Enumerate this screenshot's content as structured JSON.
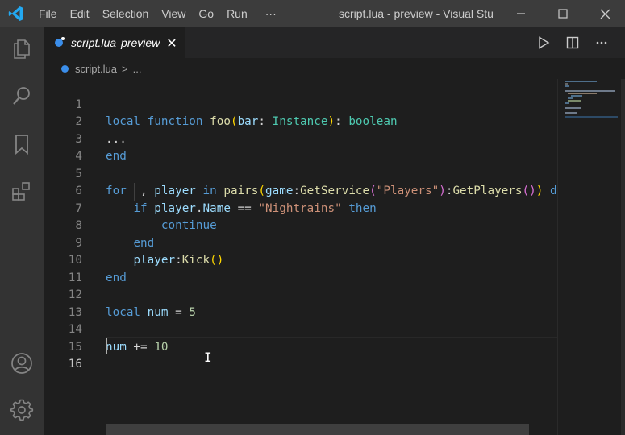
{
  "titlebar": {
    "menus": [
      "File",
      "Edit",
      "Selection",
      "View",
      "Go",
      "Run",
      "···"
    ],
    "title": "script.lua - preview - Visual Stu"
  },
  "tab": {
    "name": "script.lua",
    "suffix": "preview",
    "close": "✕"
  },
  "breadcrumb": {
    "file": "script.lua",
    "separator": ">",
    "more": "..."
  },
  "editor": {
    "line_numbers": [
      "1",
      "2",
      "3",
      "4",
      "5",
      "6",
      "7",
      "8",
      "9",
      "10",
      "11",
      "12",
      "13",
      "14",
      "15",
      "16"
    ]
  },
  "colors": {
    "accent": "#007acc",
    "keyword": "#569cd6",
    "function": "#dcdcaa",
    "string": "#ce9178"
  }
}
